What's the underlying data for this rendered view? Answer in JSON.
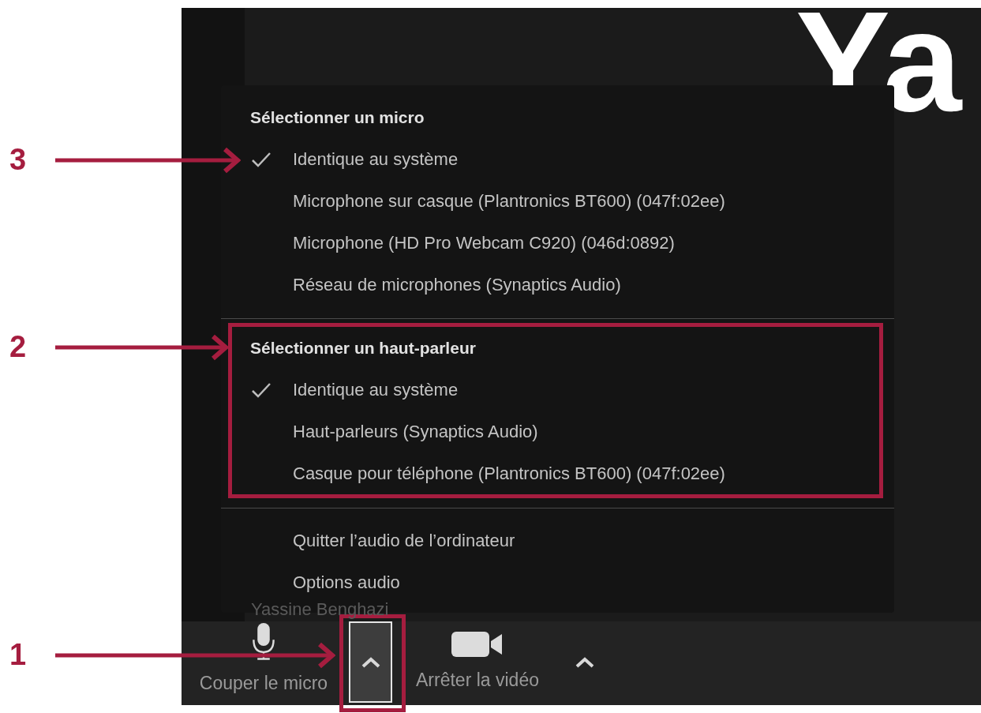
{
  "video_tile": {
    "big_text": "Ya",
    "participant_name": "Yassine Benghazi"
  },
  "audio_menu": {
    "sections": [
      {
        "heading": "Sélectionner un micro",
        "highlighted": false,
        "items": [
          {
            "label": "Identique au système",
            "checked": true
          },
          {
            "label": "Microphone sur casque (Plantronics BT600) (047f:02ee)",
            "checked": false
          },
          {
            "label": "Microphone (HD Pro Webcam C920) (046d:0892)",
            "checked": false
          },
          {
            "label": "Réseau de microphones (Synaptics Audio)",
            "checked": false
          }
        ]
      },
      {
        "heading": "Sélectionner un haut-parleur",
        "highlighted": true,
        "items": [
          {
            "label": "Identique au système",
            "checked": true
          },
          {
            "label": "Haut-parleurs (Synaptics Audio)",
            "checked": false
          },
          {
            "label": "Casque pour téléphone (Plantronics BT600) (047f:02ee)",
            "checked": false
          }
        ]
      }
    ],
    "actions": [
      "Quitter l’audio de l’ordinateur",
      "Options audio"
    ]
  },
  "toolbar": {
    "buttons": [
      {
        "kind": "mic",
        "label": "Couper le micro"
      },
      {
        "kind": "caret",
        "selected": true
      },
      {
        "kind": "video",
        "label": "Arrêter la vidéo"
      },
      {
        "kind": "caret",
        "selected": false
      }
    ]
  },
  "annotations": [
    {
      "number": "3"
    },
    {
      "number": "2"
    },
    {
      "number": "1"
    }
  ]
}
